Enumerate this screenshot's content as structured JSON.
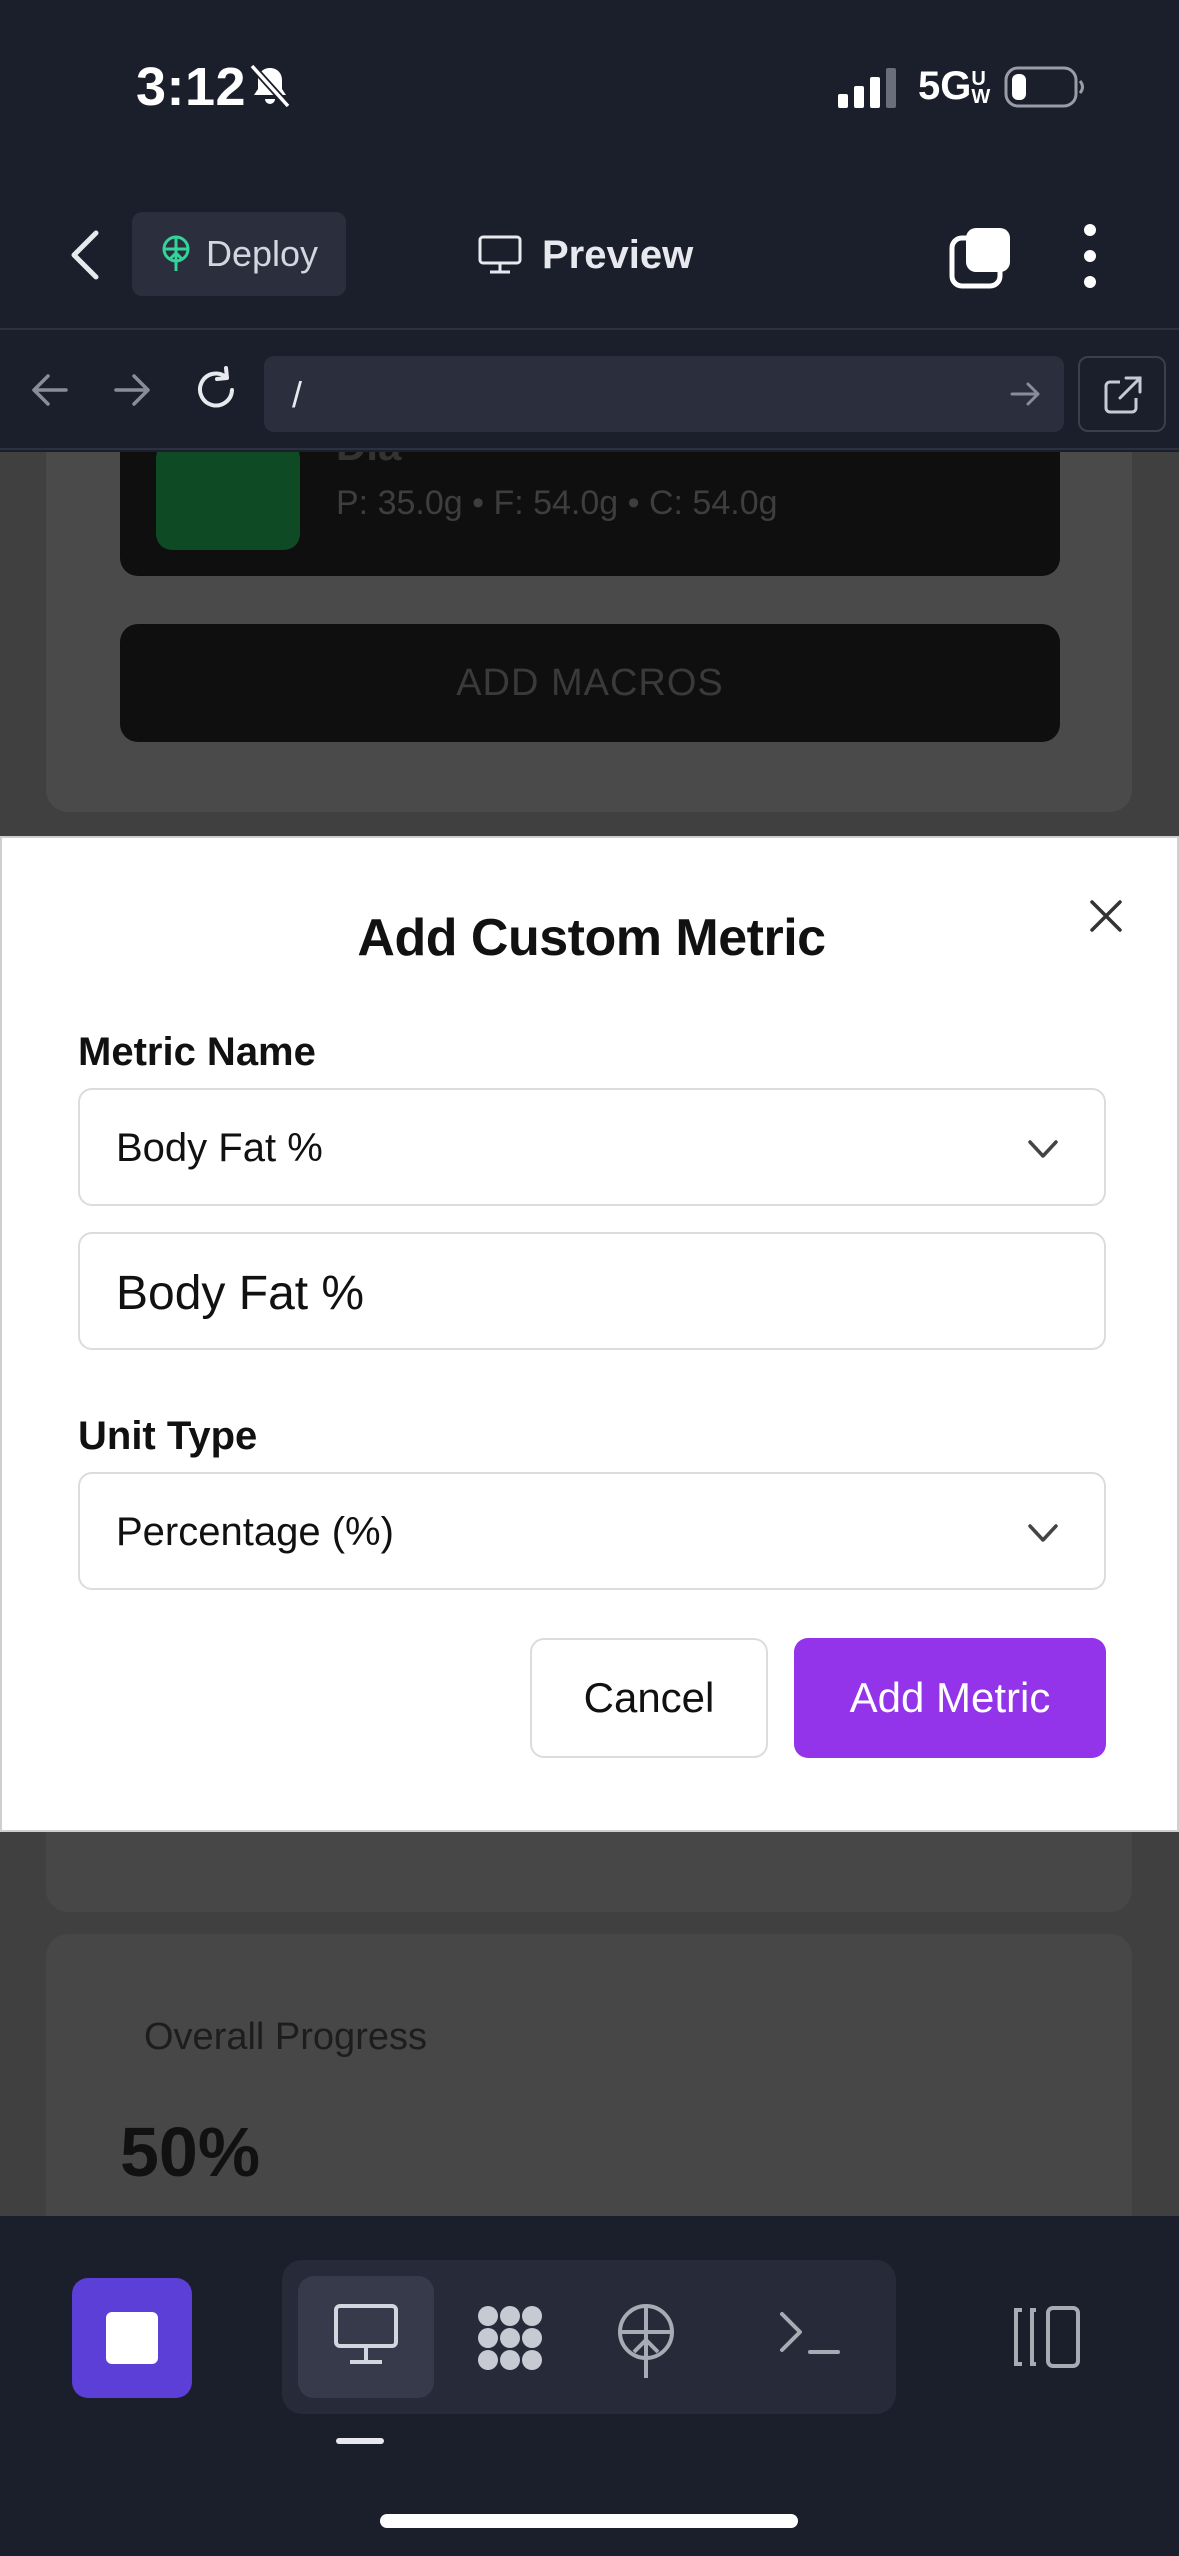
{
  "status_bar": {
    "time": "3:12",
    "network": "5G",
    "network_sub": "UW"
  },
  "app_header": {
    "deploy_label": "Deploy",
    "preview_label": "Preview"
  },
  "browser": {
    "url": "/"
  },
  "background_page": {
    "meal_name": "Dia",
    "meal_macros": "P: 35.0g • F: 54.0g • C: 54.0g",
    "add_macros_label": "ADD MACROS",
    "progress_label": "Overall Progress",
    "progress_value": "50%"
  },
  "modal": {
    "title": "Add Custom Metric",
    "metric_name_label": "Metric Name",
    "metric_name_selected": "Body Fat %",
    "metric_name_input_value": "Body Fat %",
    "unit_type_label": "Unit Type",
    "unit_type_selected": "Percentage (%)",
    "cancel_label": "Cancel",
    "submit_label": "Add Metric"
  },
  "colors": {
    "primary_button": "#9333ea",
    "stop_button": "#5b3fd6",
    "chrome_background": "#1b1e2b"
  },
  "icons": {
    "header": [
      "chevron-left-icon",
      "deploy-icon",
      "monitor-icon",
      "tabs-icon",
      "more-vertical-icon"
    ],
    "browser": [
      "arrow-left-icon",
      "arrow-right-icon",
      "reload-icon",
      "arrow-go-icon",
      "external-link-icon"
    ],
    "toolbar": [
      "stop-icon",
      "monitor-icon",
      "workflow-icon",
      "deploy-icon",
      "terminal-icon",
      "panel-icon"
    ]
  }
}
